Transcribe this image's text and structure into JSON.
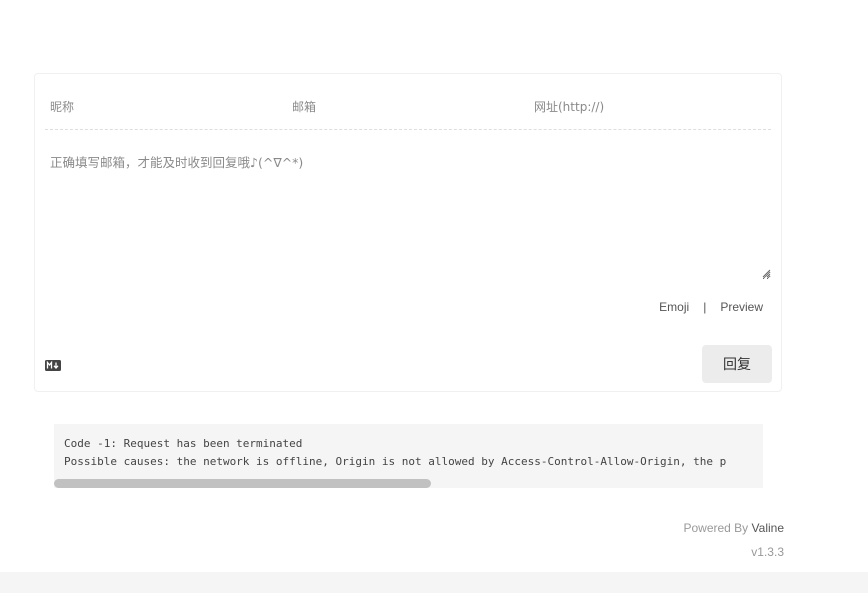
{
  "comment_form": {
    "nickname_placeholder": "昵称",
    "email_placeholder": "邮箱",
    "website_placeholder": "网址(http://)",
    "editor_placeholder": "正确填写邮箱，才能及时收到回复哦♪(^∇^*)",
    "emoji_label": "Emoji",
    "separator": "|",
    "preview_label": "Preview",
    "markdown_badge_icon": "markdown-icon",
    "submit_label": "回复"
  },
  "error_panel": {
    "line1": "Code -1: Request has been terminated",
    "line2": "Possible causes: the network is offline, Origin is not allowed by Access-Control-Allow-Origin, the p"
  },
  "footer": {
    "powered_prefix": "Powered By ",
    "powered_brand": "Valine",
    "version": "v1.3.3"
  }
}
